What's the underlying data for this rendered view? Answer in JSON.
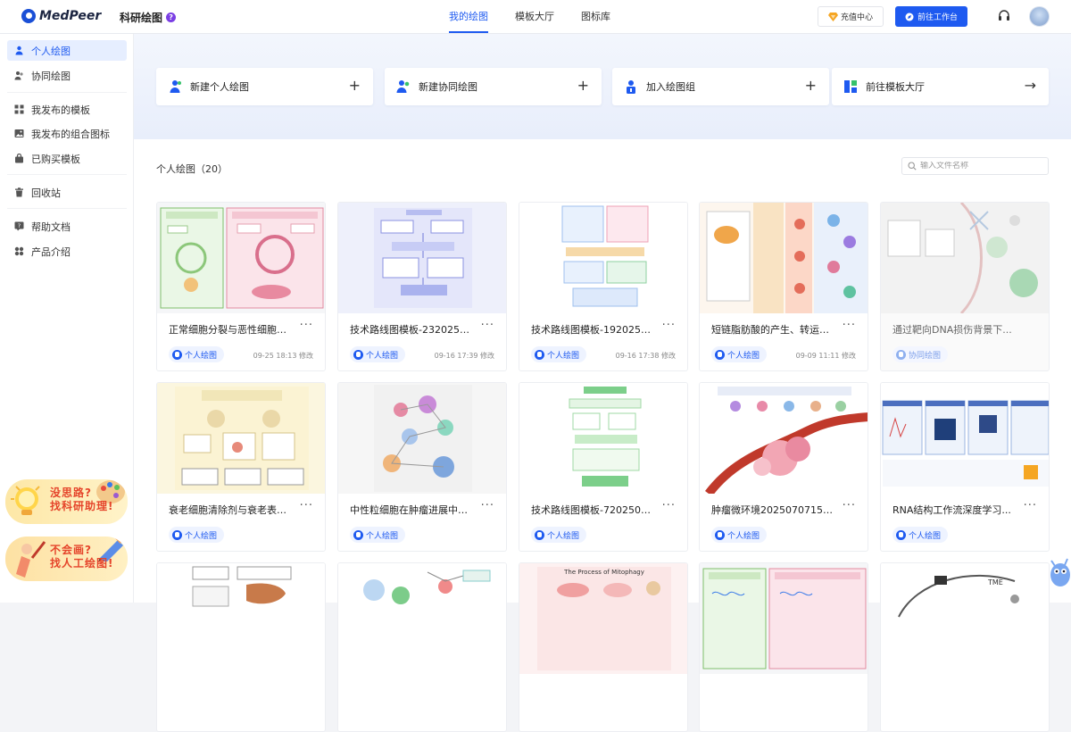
{
  "header": {
    "logo": "MedPeer",
    "app_name": "科研绘图",
    "help": "?",
    "nav": [
      {
        "label": "我的绘图",
        "active": true
      },
      {
        "label": "模板大厅",
        "active": false
      },
      {
        "label": "图标库",
        "active": false
      }
    ],
    "recharge_label": "充值中心",
    "workbench_label": "前往工作台"
  },
  "sidebar": {
    "items": [
      {
        "label": "个人绘图",
        "icon": "personal-drawing-icon",
        "active": true
      },
      {
        "label": "协同绘图",
        "icon": "collab-drawing-icon",
        "active": false
      },
      {
        "label": "我发布的模板",
        "icon": "grid-template-icon",
        "active": false
      },
      {
        "label": "我发布的组合图标",
        "icon": "image-icon",
        "active": false
      },
      {
        "label": "已购买模板",
        "icon": "bag-icon",
        "active": false
      },
      {
        "label": "回收站",
        "icon": "trash-icon",
        "active": false
      },
      {
        "label": "帮助文档",
        "icon": "help-doc-icon",
        "active": false
      },
      {
        "label": "产品介绍",
        "icon": "apps-icon",
        "active": false
      }
    ],
    "promo1": {
      "line1": "没思路?",
      "line2": "找科研助理!"
    },
    "promo2": {
      "line1": "不会画?",
      "line2": "找人工绘图!"
    }
  },
  "actions": [
    {
      "label": "新建个人绘图",
      "icon": "new-personal-icon",
      "trail": "+"
    },
    {
      "label": "新建协同绘图",
      "icon": "new-collab-icon",
      "trail": "+"
    },
    {
      "label": "加入绘图组",
      "icon": "join-group-icon",
      "trail": "+"
    },
    {
      "label": "前往模板大厅",
      "icon": "template-hall-icon",
      "trail": "→"
    }
  ],
  "list": {
    "title": "个人绘图（20）",
    "search_placeholder": "输入文件名称"
  },
  "cards": [
    {
      "title": "正常细胞分裂与恶性细胞分...",
      "tag": "个人绘图",
      "date": "09-25 18:13 修改",
      "thumb": "cell-division"
    },
    {
      "title": "技术路线图模板-23202509...",
      "tag": "个人绘图",
      "date": "09-16 17:39 修改",
      "thumb": "roadmap-purple"
    },
    {
      "title": "技术路线图模板-19202509...",
      "tag": "个人绘图",
      "date": "09-16 17:38 修改",
      "thumb": "roadmap-blue"
    },
    {
      "title": "短链脂肪酸的产生、转运体...",
      "tag": "个人绘图",
      "date": "09-09 11:11 修改",
      "thumb": "scfa"
    },
    {
      "title": "通过靶向DNA损伤背景下...",
      "tag": "协同绘图",
      "date": "",
      "thumb": "dna-damage",
      "faded": true
    },
    {
      "title": "衰老细胞清除剂与衰老表型...",
      "tag": "个人绘图",
      "date": "",
      "thumb": "senolytics"
    },
    {
      "title": "中性粒细胞在肿瘤进展中的...",
      "tag": "个人绘图",
      "date": "",
      "thumb": "neutrophil"
    },
    {
      "title": "技术路线图模板-72025070...",
      "tag": "个人绘图",
      "date": "",
      "thumb": "roadmap-green"
    },
    {
      "title": "肿瘤微环境2025070715151...",
      "tag": "个人绘图",
      "date": "",
      "thumb": "tme"
    },
    {
      "title": "RNA结构工作流深度学习...",
      "tag": "个人绘图",
      "date": "",
      "thumb": "rna"
    },
    {
      "title": "",
      "tag": "",
      "date": "",
      "thumb": "liver"
    },
    {
      "title": "",
      "tag": "",
      "date": "",
      "thumb": "memory-t"
    },
    {
      "title": "",
      "tag": "",
      "date": "",
      "thumb": "mitophagy",
      "thumb_label": "The Process of Mitophagy"
    },
    {
      "title": "",
      "tag": "",
      "date": "",
      "thumb": "cell-division-2"
    },
    {
      "title": "",
      "tag": "",
      "date": "",
      "thumb": "tme-2",
      "thumb_label": "TME"
    }
  ],
  "colors": {
    "accent": "#1e5af0",
    "promo_text": "#e5452b",
    "active_bg": "#e6eeff"
  }
}
